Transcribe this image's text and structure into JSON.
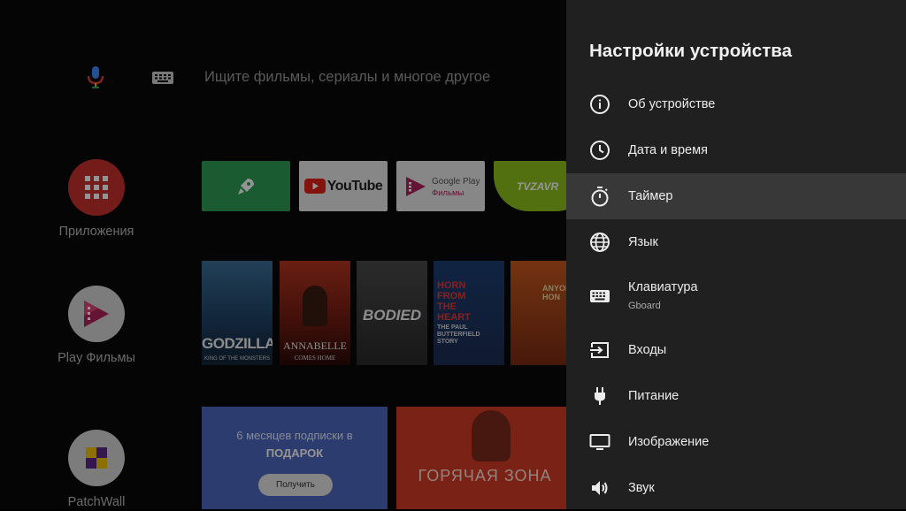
{
  "search": {
    "placeholder": "Ищите фильмы, сериалы и многое другое"
  },
  "left_nav": {
    "apps": "Приложения",
    "play_movies": "Play Фильмы",
    "patchwall": "PatchWall"
  },
  "channels": {
    "youtube": "YouTube",
    "gplay_line1": "Google Play",
    "gplay_line2": "Фильмы",
    "tvzavr": "TVZAVR"
  },
  "posters": [
    {
      "title": "GODZILLA",
      "subtitle": "KING OF THE MONSTERS"
    },
    {
      "title": "ANNABELLE",
      "subtitle": "COMES HOME"
    },
    {
      "title": "BODIED",
      "subtitle": ""
    },
    {
      "title": "HORN FROM THE HEART",
      "subtitle": "THE PAUL BUTTERFIELD STORY"
    },
    {
      "title": "ANYONE HON",
      "subtitle": ""
    }
  ],
  "banners": {
    "promo_line1": "6 месяцев подписки в",
    "promo_line2": "ПОДАРОК",
    "promo_button": "Получить",
    "movie": "ГОРЯЧАЯ ЗОНА"
  },
  "panel": {
    "title": "Настройки устройства",
    "items": [
      {
        "label": "Об устройстве",
        "icon": "info-icon"
      },
      {
        "label": "Дата и время",
        "icon": "clock-icon"
      },
      {
        "label": "Таймер",
        "icon": "timer-icon"
      },
      {
        "label": "Язык",
        "icon": "globe-icon"
      },
      {
        "label": "Клавиатура",
        "sub": "Gboard",
        "icon": "keyboard-icon"
      },
      {
        "label": "Входы",
        "icon": "input-icon"
      },
      {
        "label": "Питание",
        "icon": "power-plug-icon"
      },
      {
        "label": "Изображение",
        "icon": "display-icon"
      },
      {
        "label": "Звук",
        "icon": "speaker-icon"
      }
    ],
    "selected_index": 2
  },
  "colors": {
    "panel_bg": "#202020",
    "selected_bg": "#383838",
    "apps_red": "#c9312c",
    "rocket_green": "#2f9e55",
    "promo_blue": "#4e68bd",
    "movie_red": "#d53c26"
  }
}
